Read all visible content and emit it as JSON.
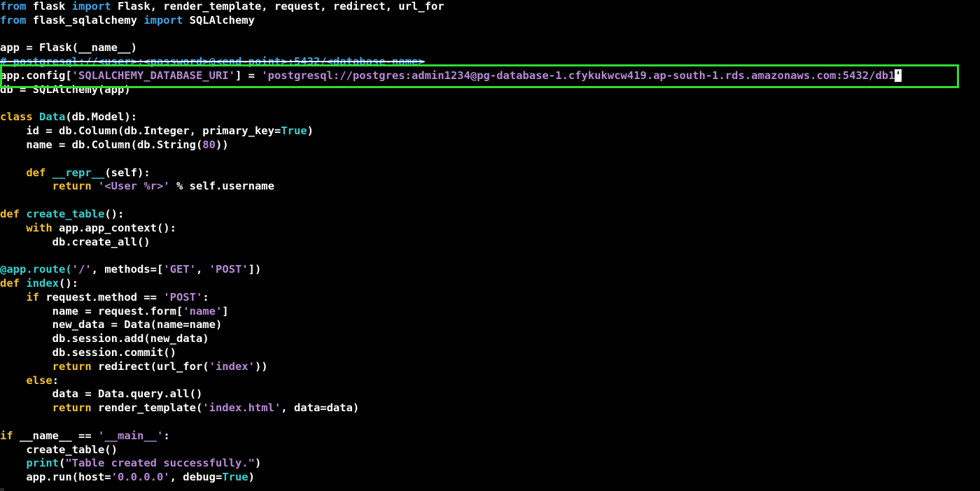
{
  "theme": {
    "background": "#000000",
    "default_text": "#ffffff",
    "keyword_color": "#3ea7ee",
    "builtin_keyword_color": "#f5c22b",
    "function_color": "#37d2d2",
    "string_color": "#b78ad6",
    "highlight_box_color": "#2fdc32"
  },
  "editor": {
    "cursor_line": 5,
    "highlighted_line": 5,
    "lines": [
      [
        {
          "t": "from",
          "c": "kw"
        },
        {
          "t": " flask ",
          "c": "plain"
        },
        {
          "t": "import",
          "c": "kw"
        },
        {
          "t": " Flask, render_template, request, redirect, url_for",
          "c": "plain"
        }
      ],
      [
        {
          "t": "from",
          "c": "kw"
        },
        {
          "t": " flask_sqlalchemy ",
          "c": "plain"
        },
        {
          "t": "import",
          "c": "kw"
        },
        {
          "t": " SQLAlchemy",
          "c": "plain"
        }
      ],
      [],
      [
        {
          "t": "app = Flask(__name__)",
          "c": "plain"
        }
      ],
      [
        {
          "t": "# postgresql://<user>:<password>@<end-point>:5432/<database-name>",
          "c": "comment strike"
        }
      ],
      [
        {
          "t": "app.config[",
          "c": "plain"
        },
        {
          "t": "'SQLALCHEMY_DATABASE_URI'",
          "c": "str"
        },
        {
          "t": "] = ",
          "c": "plain"
        },
        {
          "t": "'postgresql://postgres:admin1234@pg-database-1.cfykukwcw419.ap-south-1.rds.amazonaws.com:5432/db1",
          "c": "str"
        },
        {
          "t": "'",
          "c": "cursor"
        }
      ],
      [
        {
          "t": "db = SQLAlchemy(app)",
          "c": "plain"
        }
      ],
      [],
      [
        {
          "t": "class",
          "c": "kw2"
        },
        {
          "t": " ",
          "c": "plain"
        },
        {
          "t": "Data",
          "c": "fn"
        },
        {
          "t": "(db.Model):",
          "c": "plain"
        }
      ],
      [
        {
          "t": "    id = db.Column(db.Integer, primary_key=",
          "c": "plain"
        },
        {
          "t": "True",
          "c": "const"
        },
        {
          "t": ")",
          "c": "plain"
        }
      ],
      [
        {
          "t": "    name = db.Column(db.String(",
          "c": "plain"
        },
        {
          "t": "80",
          "c": "num"
        },
        {
          "t": "))",
          "c": "plain"
        }
      ],
      [],
      [
        {
          "t": "    ",
          "c": "plain"
        },
        {
          "t": "def",
          "c": "kw2"
        },
        {
          "t": " ",
          "c": "plain"
        },
        {
          "t": "__repr__",
          "c": "fn"
        },
        {
          "t": "(self):",
          "c": "plain"
        }
      ],
      [
        {
          "t": "        ",
          "c": "plain"
        },
        {
          "t": "return",
          "c": "kw2"
        },
        {
          "t": " ",
          "c": "plain"
        },
        {
          "t": "'<User %r>'",
          "c": "str"
        },
        {
          "t": " % self.username",
          "c": "plain"
        }
      ],
      [],
      [
        {
          "t": "def",
          "c": "kw2"
        },
        {
          "t": " ",
          "c": "plain"
        },
        {
          "t": "create_table",
          "c": "fn"
        },
        {
          "t": "():",
          "c": "plain"
        }
      ],
      [
        {
          "t": "    ",
          "c": "plain"
        },
        {
          "t": "with",
          "c": "kw2"
        },
        {
          "t": " app.app_context():",
          "c": "plain"
        }
      ],
      [
        {
          "t": "        db.create_all()",
          "c": "plain"
        }
      ],
      [],
      [
        {
          "t": "@app.route(",
          "c": "fn"
        },
        {
          "t": "'/'",
          "c": "str"
        },
        {
          "t": ", methods=[",
          "c": "plain"
        },
        {
          "t": "'GET'",
          "c": "str"
        },
        {
          "t": ", ",
          "c": "plain"
        },
        {
          "t": "'POST'",
          "c": "str"
        },
        {
          "t": "])",
          "c": "plain"
        }
      ],
      [
        {
          "t": "def",
          "c": "kw2"
        },
        {
          "t": " ",
          "c": "plain"
        },
        {
          "t": "index",
          "c": "fn"
        },
        {
          "t": "():",
          "c": "plain"
        }
      ],
      [
        {
          "t": "    ",
          "c": "plain"
        },
        {
          "t": "if",
          "c": "kw2"
        },
        {
          "t": " request.method == ",
          "c": "plain"
        },
        {
          "t": "'POST'",
          "c": "str"
        },
        {
          "t": ":",
          "c": "plain"
        }
      ],
      [
        {
          "t": "        name = request.form[",
          "c": "plain"
        },
        {
          "t": "'name'",
          "c": "str"
        },
        {
          "t": "]",
          "c": "plain"
        }
      ],
      [
        {
          "t": "        new_data = Data(name=name)",
          "c": "plain"
        }
      ],
      [
        {
          "t": "        db.session.add(new_data)",
          "c": "plain"
        }
      ],
      [
        {
          "t": "        db.session.commit()",
          "c": "plain"
        }
      ],
      [
        {
          "t": "        ",
          "c": "plain"
        },
        {
          "t": "return",
          "c": "kw2"
        },
        {
          "t": " redirect(url_for(",
          "c": "plain"
        },
        {
          "t": "'index'",
          "c": "str"
        },
        {
          "t": "))",
          "c": "plain"
        }
      ],
      [
        {
          "t": "    ",
          "c": "plain"
        },
        {
          "t": "else",
          "c": "kw2"
        },
        {
          "t": ":",
          "c": "plain"
        }
      ],
      [
        {
          "t": "        data = Data.query.all()",
          "c": "plain"
        }
      ],
      [
        {
          "t": "        ",
          "c": "plain"
        },
        {
          "t": "return",
          "c": "kw2"
        },
        {
          "t": " render_template(",
          "c": "plain"
        },
        {
          "t": "'index.html'",
          "c": "str"
        },
        {
          "t": ", data=data)",
          "c": "plain"
        }
      ],
      [],
      [
        {
          "t": "if",
          "c": "kw2"
        },
        {
          "t": " __name__ == ",
          "c": "plain"
        },
        {
          "t": "'__main__'",
          "c": "str"
        },
        {
          "t": ":",
          "c": "plain"
        }
      ],
      [
        {
          "t": "    create_table()",
          "c": "plain"
        }
      ],
      [
        {
          "t": "    ",
          "c": "plain"
        },
        {
          "t": "print",
          "c": "fn"
        },
        {
          "t": "(",
          "c": "plain"
        },
        {
          "t": "\"Table created successfully.\"",
          "c": "str"
        },
        {
          "t": ")",
          "c": "plain"
        }
      ],
      [
        {
          "t": "    app.run(host=",
          "c": "plain"
        },
        {
          "t": "'0.0.0.0'",
          "c": "str"
        },
        {
          "t": ", debug=",
          "c": "plain"
        },
        {
          "t": "True",
          "c": "const"
        },
        {
          "t": ")",
          "c": "plain"
        }
      ]
    ]
  }
}
